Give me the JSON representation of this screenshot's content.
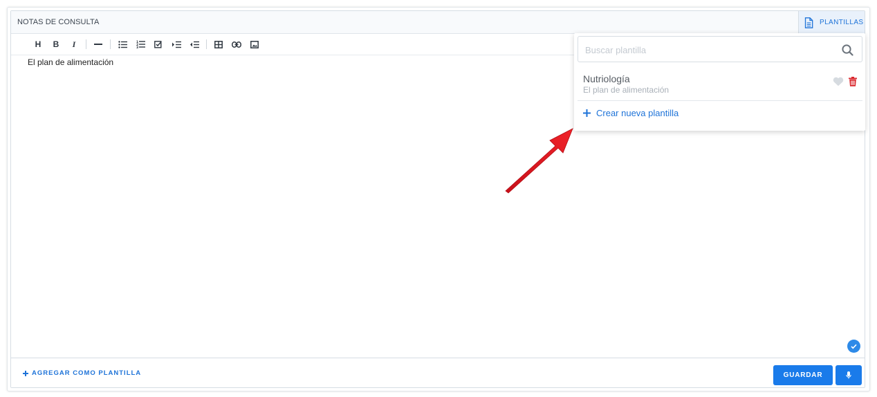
{
  "header": {
    "title": "NOTAS DE CONSULTA",
    "templates_button": "PLANTILLAS"
  },
  "toolbar": {
    "buttons": [
      "heading-icon",
      "bold-icon",
      "italic-icon",
      "horizontal-rule-icon",
      "bullet-list-icon",
      "numbered-list-icon",
      "checklist-icon",
      "indent-icon",
      "outdent-icon",
      "table-icon",
      "link-icon",
      "image-icon"
    ],
    "heading_label": "H",
    "bold_label": "B",
    "italic_label": "I"
  },
  "editor": {
    "content": "El plan de alimentación"
  },
  "dropdown": {
    "search_placeholder": "Buscar plantilla",
    "templates": [
      {
        "name": "Nutriología",
        "description": "El plan de alimentación"
      }
    ],
    "create_label": "Crear nueva plantilla"
  },
  "footer": {
    "add_template_label": "AGREGAR COMO PLANTILLA",
    "save_label": "GUARDAR"
  },
  "colors": {
    "accent": "#1a7bea",
    "delete": "#d9262c",
    "annotation_arrow": "#e0161e"
  }
}
